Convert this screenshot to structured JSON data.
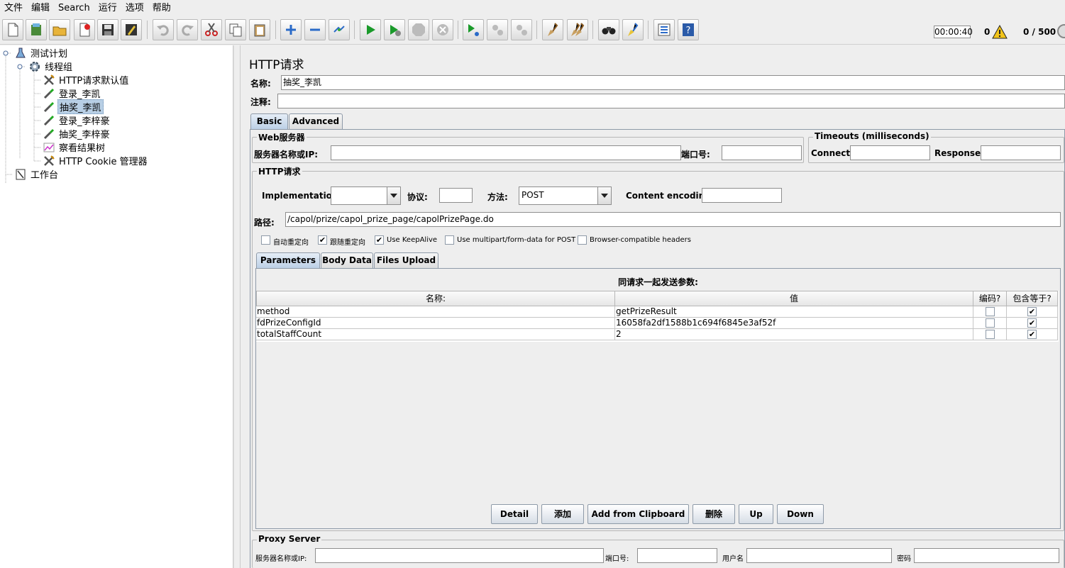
{
  "menu": [
    "文件",
    "编辑",
    "Search",
    "运行",
    "选项",
    "帮助"
  ],
  "status": {
    "timer": "00:00:40",
    "error_count": "0",
    "threads": "0 / 500"
  },
  "tree": [
    {
      "label": "测试计划"
    },
    {
      "label": "线程组"
    },
    {
      "label": "HTTP请求默认值"
    },
    {
      "label": "登录_李凯"
    },
    {
      "label": "抽奖_李凯"
    },
    {
      "label": "登录_李梓豪"
    },
    {
      "label": "抽奖_李梓豪"
    },
    {
      "label": "察看结果树"
    },
    {
      "label": "HTTP Cookie 管理器"
    },
    {
      "label": "工作台"
    }
  ],
  "panel": {
    "title": "HTTP请求",
    "name_label": "名称:",
    "name_value": "抽奖_李凯",
    "comment_label": "注释:",
    "comment_value": "",
    "tabs": [
      "Basic",
      "Advanced"
    ],
    "web_server": {
      "title": "Web服务器",
      "server_label": "服务器名称或IP:",
      "server_value": "",
      "port_label": "端口号:",
      "port_value": ""
    },
    "timeouts": {
      "title": "Timeouts (milliseconds)",
      "connect_label": "Connect:",
      "connect_value": "",
      "response_label": "Response:",
      "response_value": ""
    },
    "http_request": {
      "title": "HTTP请求",
      "implementation_label": "Implementation:",
      "implementation_value": "",
      "protocol_label": "协议:",
      "protocol_value": "",
      "method_label": "方法:",
      "method_value": "POST",
      "encoding_label": "Content encoding:",
      "encoding_value": "",
      "path_label": "路径:",
      "path_value": "/capol/prize/capol_prize_page/capolPrizePage.do"
    },
    "options": [
      {
        "label": "自动重定向",
        "checked": false
      },
      {
        "label": "跟随重定向",
        "checked": true
      },
      {
        "label": "Use KeepAlive",
        "checked": true
      },
      {
        "label": "Use multipart/form-data for POST",
        "checked": false
      },
      {
        "label": "Browser-compatible headers",
        "checked": false
      }
    ],
    "sub_tabs": [
      "Parameters",
      "Body Data",
      "Files Upload"
    ],
    "params_caption": "同请求一起发送参数:",
    "columns": [
      "名称:",
      "值",
      "编码?",
      "包含等于?"
    ],
    "rows": [
      {
        "name": "method",
        "value": "getPrizeResult",
        "encode": false,
        "include_equals": true
      },
      {
        "name": "fdPrizeConfigId",
        "value": "16058fa2df1588b1c694f6845e3af52f",
        "encode": false,
        "include_equals": true
      },
      {
        "name": "totalStaffCount",
        "value": "2",
        "encode": false,
        "include_equals": true
      }
    ],
    "buttons": [
      "Detail",
      "添加",
      "Add from Clipboard",
      "删除",
      "Up",
      "Down"
    ],
    "proxy": {
      "title": "Proxy Server",
      "server_label": "服务器名称或IP:",
      "server_value": "",
      "port_label": "端口号:",
      "port_value": "",
      "user_label": "用户名",
      "user_value": "",
      "password_label": "密码",
      "password_value": ""
    }
  },
  "colors": {
    "selection": "#b8cfe5",
    "tab_active": "#bcd0e6",
    "panel_bg": "#eeeeee"
  }
}
